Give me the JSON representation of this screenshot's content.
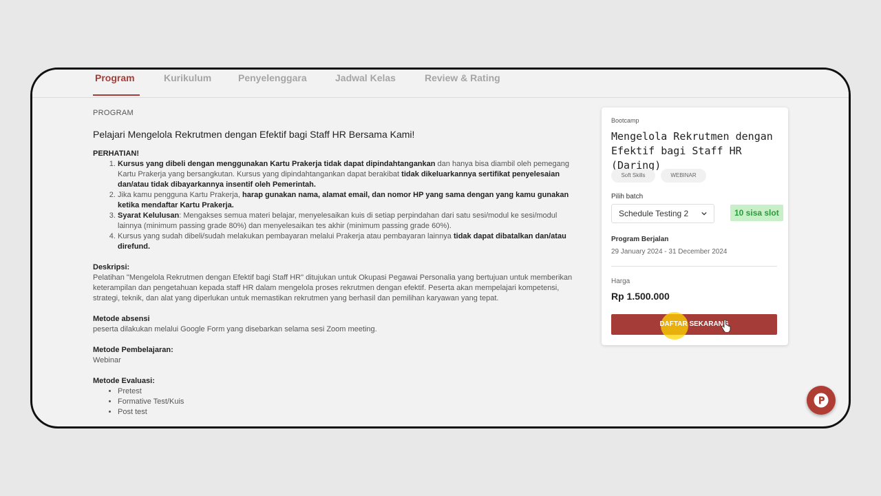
{
  "tabs": [
    "Program",
    "Kurikulum",
    "Penyelenggara",
    "Jadwal Kelas",
    "Review & Rating"
  ],
  "active_tab": "Program",
  "section_label": "PROGRAM",
  "headline": "Pelajari Mengelola Rekrutmen dengan Efektif bagi Staff HR Bersama Kami!",
  "attention": {
    "title": "PERHATIAN!",
    "items": [
      {
        "b1": "Kursus yang dibeli dengan menggunakan Kartu Prakerja tidak dapat dipindahtangankan",
        "t1": " dan hanya bisa diambil oleh pemegang Kartu Prakerja yang bersangkutan. Kursus yang dipindahtangankan dapat berakibat ",
        "b2": "tidak dikeluarkannya sertifikat penyelesaian dan/atau tidak dibayarkannya insentif oleh Pemerintah.",
        "t2": ""
      },
      {
        "b1": "",
        "t1": "Jika kamu pengguna Kartu Prakerja, ",
        "b2": "harap gunakan nama, alamat email, dan nomor HP yang sama dengan yang kamu gunakan ketika mendaftar Kartu Prakerja.",
        "t2": ""
      },
      {
        "b1": "Syarat Kelulusan",
        "t1": ": Mengakses semua materi belajar, menyelesaikan kuis di setiap perpindahan dari satu sesi/modul ke sesi/modul lainnya (minimum passing grade 80%) dan menyelesaikan tes akhir (minimum passing grade 60%).",
        "b2": "",
        "t2": ""
      },
      {
        "b1": "",
        "t1": "Kursus yang sudah dibeli/sudah melakukan pembayaran melalui Prakerja atau pembayaran lainnya ",
        "b2": "tidak dapat dibatalkan dan/atau direfund.",
        "t2": ""
      }
    ]
  },
  "description": {
    "title": "Deskripsi:",
    "text": "Pelatihan \"Mengelola Rekrutmen dengan Efektif bagi Staff HR\" ditujukan untuk Okupasi Pegawai Personalia yang bertujuan untuk memberikan keterampilan dan pengetahuan kepada staff HR dalam mengelola proses rekrutmen dengan efektif. Peserta akan mempelajari kompetensi, strategi, teknik, dan alat yang diperlukan untuk memastikan rekrutmen yang berhasil dan pemilihan karyawan yang tepat."
  },
  "attendance": {
    "title": "Metode absensi",
    "text": "peserta dilakukan melalui Google Form yang disebarkan selama sesi Zoom meeting."
  },
  "learning": {
    "title": "Metode Pembelajaran:",
    "text": "Webinar"
  },
  "evaluation": {
    "title": "Metode Evaluasi:",
    "items": [
      "Pretest",
      "Formative Test/Kuis",
      "Post test"
    ]
  },
  "card": {
    "type": "Bootcamp",
    "title": "Mengelola Rekrutmen dengan Efektif bagi Staff HR (Daring)",
    "chips": [
      "Soft Skills",
      "WEBINAR"
    ],
    "batch_label": "Pilih batch",
    "batch_value": "Schedule Testing 2",
    "slots": "10 sisa slot",
    "running_label": "Program Berjalan",
    "running_dates": "29 January 2024 - 31 December 2024",
    "price_label": "Harga",
    "price": "Rp 1.500.000",
    "cta": "DAFTAR SEKARANG"
  },
  "colors": {
    "accent": "#a53c37",
    "slot_bg": "#c8f0c8",
    "slot_text": "#2a9a3a"
  }
}
